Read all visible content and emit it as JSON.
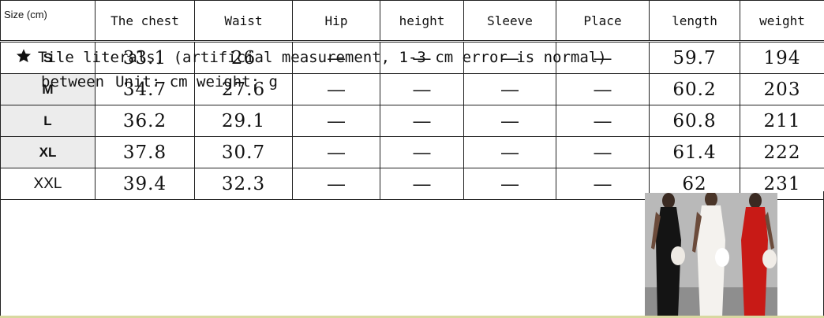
{
  "table": {
    "headers": [
      "Size (cm)",
      "The chest",
      "Waist",
      "Hip",
      "height",
      "Sleeve",
      "Place",
      "length",
      "weight"
    ],
    "rows": [
      {
        "size": "S",
        "chest": "33.1",
        "waist": "26",
        "hip": "—",
        "height": "—",
        "sleeve": "—",
        "place": "—",
        "length": "59.7",
        "weight": "194"
      },
      {
        "size": "M",
        "chest": "34.7",
        "waist": "27.6",
        "hip": "—",
        "height": "—",
        "sleeve": "—",
        "place": "—",
        "length": "60.2",
        "weight": "203"
      },
      {
        "size": "L",
        "chest": "36.2",
        "waist": "29.1",
        "hip": "—",
        "height": "—",
        "sleeve": "—",
        "place": "—",
        "length": "60.8",
        "weight": "211"
      },
      {
        "size": "XL",
        "chest": "37.8",
        "waist": "30.7",
        "hip": "—",
        "height": "—",
        "sleeve": "—",
        "place": "—",
        "length": "61.4",
        "weight": "222"
      },
      {
        "size": "XXL",
        "chest": "39.4",
        "waist": "32.3",
        "hip": "—",
        "height": "—",
        "sleeve": "—",
        "place": "—",
        "length": "62",
        "weight": "231"
      }
    ]
  },
  "note": {
    "icon": "star-icon",
    "line1": "Tile literals, (artificial measurement, 1-3 cm error is normal)",
    "line2_prefix": "between",
    "line2_unit": "Unit: cm weight: g"
  },
  "photo": {
    "figures": [
      "black",
      "white",
      "red"
    ],
    "colors": {
      "black": "#141414",
      "white": "#f4f2ee",
      "red": "#c81a16"
    }
  }
}
